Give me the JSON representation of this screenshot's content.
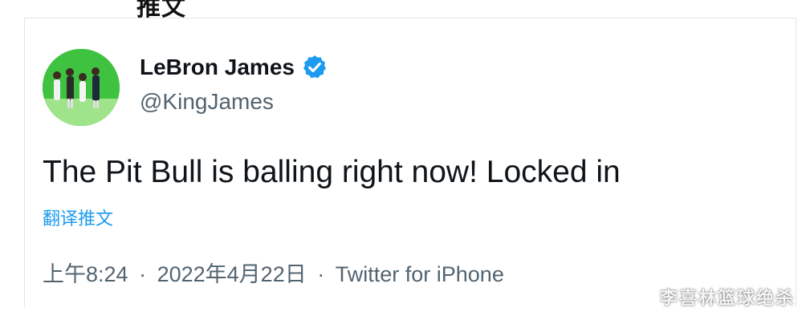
{
  "top_fragment": "推文",
  "tweet": {
    "author": {
      "display_name": "LeBron James",
      "handle": "@KingJames",
      "verified": true,
      "avatar_icon": "avatar-photo"
    },
    "text": "The Pit Bull is balling right now! Locked in",
    "translate_label": "翻译推文",
    "time": "上午8:24",
    "date": "2022年4月22日",
    "source": "Twitter for iPhone",
    "separator": "·"
  },
  "watermark": "李喜林篮球绝杀",
  "colors": {
    "text_primary": "#0f1419",
    "text_secondary": "#536471",
    "link": "#1d9bf0",
    "verified": "#1d9bf0",
    "avatar_bg": "#3fc23f"
  }
}
